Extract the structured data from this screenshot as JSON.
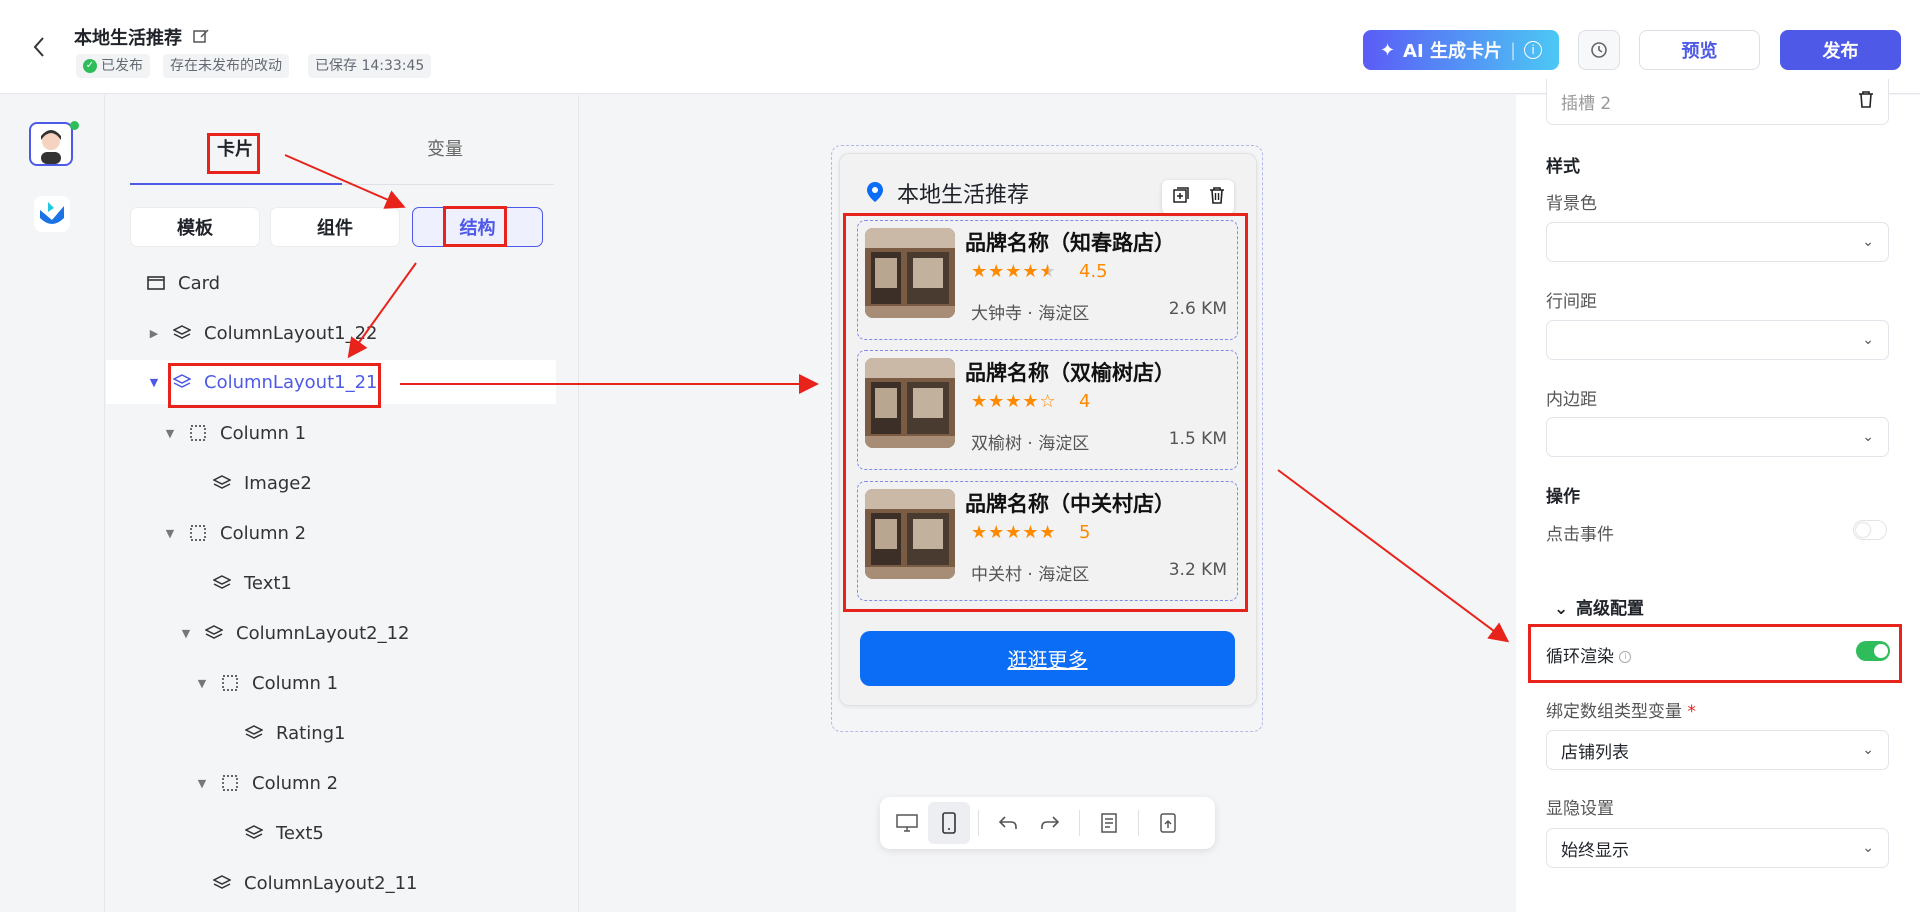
{
  "header": {
    "title": "本地生活推荐",
    "status_published": "已发布",
    "status_unpublished": "存在未发布的改动",
    "status_saved": "已保存 14:33:45",
    "ai_button": "AI 生成卡片",
    "preview_button": "预览",
    "publish_button": "发布"
  },
  "left_panel": {
    "tabs": [
      "卡片",
      "变量"
    ],
    "segments": [
      "模板",
      "组件",
      "结构"
    ],
    "tree": [
      {
        "label": "Card",
        "icon": "card-icon"
      },
      {
        "label": "ColumnLayout1_22",
        "icon": "layers-icon",
        "toggle": "collapsed"
      },
      {
        "label": "ColumnLayout1_21",
        "icon": "layers-icon",
        "toggle": "expanded",
        "selected": true
      },
      {
        "label": "Column 1",
        "icon": "column-icon",
        "toggle": "expanded"
      },
      {
        "label": "Image2",
        "icon": "layers-icon"
      },
      {
        "label": "Column 2",
        "icon": "column-icon",
        "toggle": "expanded"
      },
      {
        "label": "Text1",
        "icon": "layers-icon"
      },
      {
        "label": "ColumnLayout2_12",
        "icon": "layers-icon",
        "toggle": "expanded"
      },
      {
        "label": "Column 1",
        "icon": "column-icon",
        "toggle": "expanded"
      },
      {
        "label": "Rating1",
        "icon": "layers-icon"
      },
      {
        "label": "Column 2",
        "icon": "column-icon",
        "toggle": "expanded"
      },
      {
        "label": "Text5",
        "icon": "layers-icon"
      },
      {
        "label": "ColumnLayout2_11",
        "icon": "layers-icon"
      }
    ]
  },
  "card": {
    "title": "本地生活推荐",
    "items": [
      {
        "name": "品牌名称（知春路店）",
        "rating": "4.5",
        "location": "大钟寺 · 海淀区",
        "distance": "2.6 KM"
      },
      {
        "name": "品牌名称（双榆树店）",
        "rating": "4",
        "location": "双榆树 · 海淀区",
        "distance": "1.5 KM"
      },
      {
        "name": "品牌名称（中关村店）",
        "rating": "5",
        "location": "中关村 · 海淀区",
        "distance": "3.2 KM"
      }
    ],
    "more_button": "逛逛更多"
  },
  "right_panel": {
    "top_field": "插槽 2",
    "style_section": "样式",
    "bg_label": "背景色",
    "line_spacing_label": "行间距",
    "padding_label": "内边距",
    "action_section": "操作",
    "click_event_label": "点击事件",
    "advanced_section": "高级配置",
    "loop_render_label": "循环渲染",
    "bind_array_label": "绑定数组类型变量",
    "bind_array_required": "*",
    "bind_array_value": "店铺列表",
    "visibility_label": "显隐设置",
    "visibility_value": "始终显示",
    "loop_render_enabled": true,
    "click_event_enabled": false
  },
  "colors": {
    "accent": "#4e59e8",
    "annotation": "#e8231c",
    "rating": "#ff8a00",
    "cta": "#0b6cf6",
    "toggle_on": "#2fbd5b"
  }
}
